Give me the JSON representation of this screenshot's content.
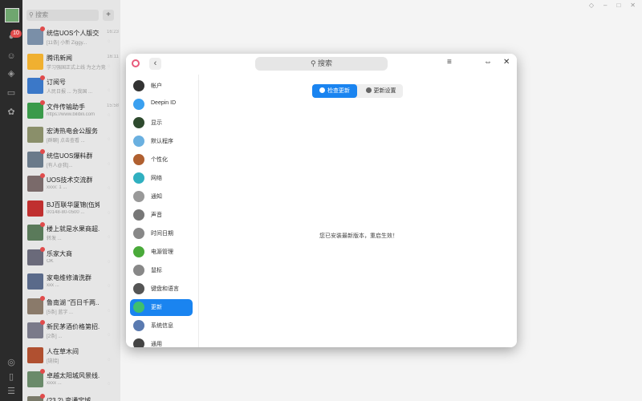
{
  "desktop": {
    "controls": [
      "◇",
      "–",
      "□",
      "✕"
    ]
  },
  "wechat": {
    "badge": "10",
    "search_placeholder": "搜索",
    "add_label": "+",
    "chats": [
      {
        "name": "统信UOS个人版交流...",
        "preview": "[11条] 小新 Ziggy...",
        "time": "16:23",
        "color": "#7a8fa8"
      },
      {
        "name": "腾讯新闻",
        "preview": "学习强国正式上线 为之力竞...",
        "time": "16:11",
        "color": "#f0b030"
      },
      {
        "name": "订阅号",
        "preview": "人民日报 ... 为我国 ...",
        "time": "",
        "color": "#3b78c8"
      },
      {
        "name": "文件传输助手",
        "preview": "https://www.bilibili.com",
        "time": "15:58",
        "color": "#3a9a4a"
      },
      {
        "name": "宏涛热电会公服务",
        "preview": "[群聊] 点击查看 ...",
        "time": "",
        "color": "#8a8f6a"
      },
      {
        "name": "统信UOS爆料群",
        "preview": "[有人@我]...",
        "time": "",
        "color": "#6a7a8a"
      },
      {
        "name": "UOS技术交流群",
        "preview": "xxxx: 1 ...",
        "time": "",
        "color": "#7a6a6a"
      },
      {
        "name": "BJ百联华厦锦(伍婷...",
        "preview": "00148-80-0500 ...",
        "time": "",
        "color": "#c03030"
      },
      {
        "name": "楼上就是水果商超...",
        "preview": "转发 ...",
        "time": "",
        "color": "#5a7a5a"
      },
      {
        "name": "乐家大商",
        "preview": "OK",
        "time": "",
        "color": "#6a6a7a"
      },
      {
        "name": "家电维修清洗群",
        "preview": "xxx ...",
        "time": "",
        "color": "#5a6a8a"
      },
      {
        "name": "鲁南湖 \"百日千两...",
        "preview": "[5条] 蓝字 ...",
        "time": "",
        "color": "#8a7a6a"
      },
      {
        "name": "新民茅酒价格第招...",
        "preview": "[2条] ...",
        "time": "",
        "color": "#7a7a8a"
      },
      {
        "name": "人在草木间",
        "preview": "[链接]",
        "time": "",
        "color": "#b05030"
      },
      {
        "name": "卓越太阳城风景线...",
        "preview": "xxxx ...",
        "time": "",
        "color": "#6a8a6a"
      },
      {
        "name": "(23.2) 变通宝城...",
        "preview": "",
        "time": "",
        "color": "#7a7a6a"
      }
    ]
  },
  "settings": {
    "search_placeholder": "搜索",
    "back_icon": "‹",
    "menu_icon": "≡",
    "restore_icon": "⇔",
    "close_icon": "✕",
    "nav": [
      {
        "label": "帐户",
        "color": "#333333",
        "active": false
      },
      {
        "label": "Deepin ID",
        "color": "#3aa0f0",
        "active": false
      },
      {
        "label": "显示",
        "color": "#2e4a2e",
        "active": false
      },
      {
        "label": "默认程序",
        "color": "#6ab0e0",
        "active": false
      },
      {
        "label": "个性化",
        "color": "#b06030",
        "active": false
      },
      {
        "label": "网络",
        "color": "#30b0c0",
        "active": false
      },
      {
        "label": "通知",
        "color": "#999999",
        "active": false
      },
      {
        "label": "声音",
        "color": "#777777",
        "active": false
      },
      {
        "label": "时间日期",
        "color": "#888888",
        "active": false
      },
      {
        "label": "电源管理",
        "color": "#4aaa3a",
        "active": false
      },
      {
        "label": "鼠标",
        "color": "#888888",
        "active": false
      },
      {
        "label": "键盘和语言",
        "color": "#555555",
        "active": false
      },
      {
        "label": "更新",
        "color": "#3fbf6f",
        "active": true
      },
      {
        "label": "系统信息",
        "color": "#5a7ab0",
        "active": false
      },
      {
        "label": "通用",
        "color": "#444444",
        "active": false
      }
    ],
    "tabs": [
      {
        "label": "检查更新",
        "active": true
      },
      {
        "label": "更新设置",
        "active": false
      }
    ],
    "status": "您已安装最新版本，重启生效！"
  }
}
